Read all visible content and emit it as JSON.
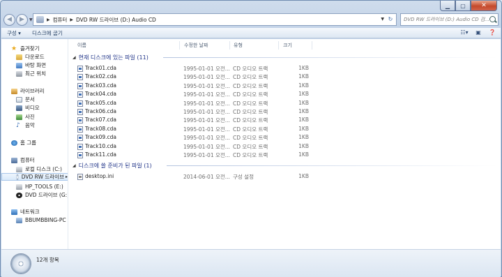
{
  "window": {
    "controls": {
      "minimize": "▁",
      "maximize": "▢",
      "close": "✕"
    }
  },
  "address": {
    "crumbs": [
      "컴퓨터",
      "DVD RW 드라이브 (D:) Audio CD"
    ],
    "search_placeholder": "DVD RW 드라이브 (D:) Audio CD 검..."
  },
  "toolbar": {
    "organize": "구성 ▾",
    "burn": "디스크에 굽기"
  },
  "nav": {
    "favorites": "즐겨찾기",
    "downloads": "다운로드",
    "desktop": "바탕 화면",
    "recent": "최근 위치",
    "libraries": "라이브러리",
    "documents": "문서",
    "videos": "비디오",
    "pictures": "사진",
    "music": "음악",
    "homegroup": "홈 그룹",
    "computer": "컴퓨터",
    "local_disk": "로컬 디스크 (C:)",
    "dvd_rw": "DVD RW 드라이브",
    "hp_tools": "HP_TOOLS (E:)",
    "dvd_g": "DVD 드라이브 (G:)",
    "network": "네트워크",
    "pc_name": "BBUMBBING-PC"
  },
  "columns": {
    "name": "이름",
    "date": "수정한 날짜",
    "type": "유형",
    "size": "크기"
  },
  "groups": {
    "on_disc": "현재 디스크에 있는 파일 (11)",
    "ready": "디스크에 쓸 준비가 된 파일 (1)"
  },
  "files_on_disc": [
    {
      "name": "Track01.cda",
      "date": "1995-01-01 오전...",
      "type": "CD 오디오 트랙",
      "size": "1KB"
    },
    {
      "name": "Track02.cda",
      "date": "1995-01-01 오전...",
      "type": "CD 오디오 트랙",
      "size": "1KB"
    },
    {
      "name": "Track03.cda",
      "date": "1995-01-01 오전...",
      "type": "CD 오디오 트랙",
      "size": "1KB"
    },
    {
      "name": "Track04.cda",
      "date": "1995-01-01 오전...",
      "type": "CD 오디오 트랙",
      "size": "1KB"
    },
    {
      "name": "Track05.cda",
      "date": "1995-01-01 오전...",
      "type": "CD 오디오 트랙",
      "size": "1KB"
    },
    {
      "name": "Track06.cda",
      "date": "1995-01-01 오전...",
      "type": "CD 오디오 트랙",
      "size": "1KB"
    },
    {
      "name": "Track07.cda",
      "date": "1995-01-01 오전...",
      "type": "CD 오디오 트랙",
      "size": "1KB"
    },
    {
      "name": "Track08.cda",
      "date": "1995-01-01 오전...",
      "type": "CD 오디오 트랙",
      "size": "1KB"
    },
    {
      "name": "Track09.cda",
      "date": "1995-01-01 오전...",
      "type": "CD 오디오 트랙",
      "size": "1KB"
    },
    {
      "name": "Track10.cda",
      "date": "1995-01-01 오전...",
      "type": "CD 오디오 트랙",
      "size": "1KB"
    },
    {
      "name": "Track11.cda",
      "date": "1995-01-01 오전...",
      "type": "CD 오디오 트랙",
      "size": "1KB"
    }
  ],
  "files_ready": [
    {
      "name": "desktop.ini",
      "date": "2014-06-01 오전...",
      "type": "구성 설정",
      "size": "1KB"
    }
  ],
  "status": {
    "item_count": "12개 항목"
  }
}
